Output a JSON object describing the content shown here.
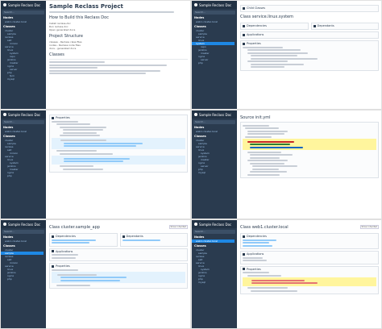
{
  "brand": {
    "title": "Sample Reclass Doc"
  },
  "sidebar": {
    "search_placeholder": "Search...",
    "nodes_heading": "Nodes",
    "classes_heading": "Classes",
    "nodes": [
      "web1.cluster.local"
    ],
    "classes": [
      "cluster",
      "sample",
      "reclass",
      "salt",
      "minion",
      "service",
      "linux",
      "system",
      "repo",
      "jenkins",
      "master",
      "single",
      "nginx",
      "server",
      "php",
      "fpm",
      "mysql"
    ]
  },
  "p1": {
    "title": "Sample Reclass Project",
    "build_heading": "How to Build this Reclass Doc",
    "build_items": [
      "Install reclass-doc",
      "Run reclass-doc",
      "Open generated docs"
    ],
    "structure_heading": "Project Structure",
    "structure_items": [
      "classes - Reclass class files",
      "nodes - Reclass node files",
      "docs - generated docs"
    ],
    "classes_heading": "Classes"
  },
  "p2": {
    "child_heading": "Child Classes",
    "class_title": "Class service.linux.system",
    "dependencies": "Dependencies",
    "dependants": "Dependants",
    "applications": "Applications",
    "properties": "Properties"
  },
  "p3": {
    "properties": "Properties"
  },
  "p4": {
    "source_title": "Source init.yml"
  },
  "p5": {
    "class_title": "Class cluster.sample_app",
    "dependencies": "Dependencies",
    "dependants": "Dependants",
    "applications": "Applications",
    "properties": "Properties",
    "show_inherited": "Show inherited"
  },
  "p6": {
    "class_title": "Class web1.cluster.local",
    "dependencies": "Dependencies",
    "applications": "Applications",
    "properties": "Properties",
    "show_inherited": "Show inherited"
  }
}
